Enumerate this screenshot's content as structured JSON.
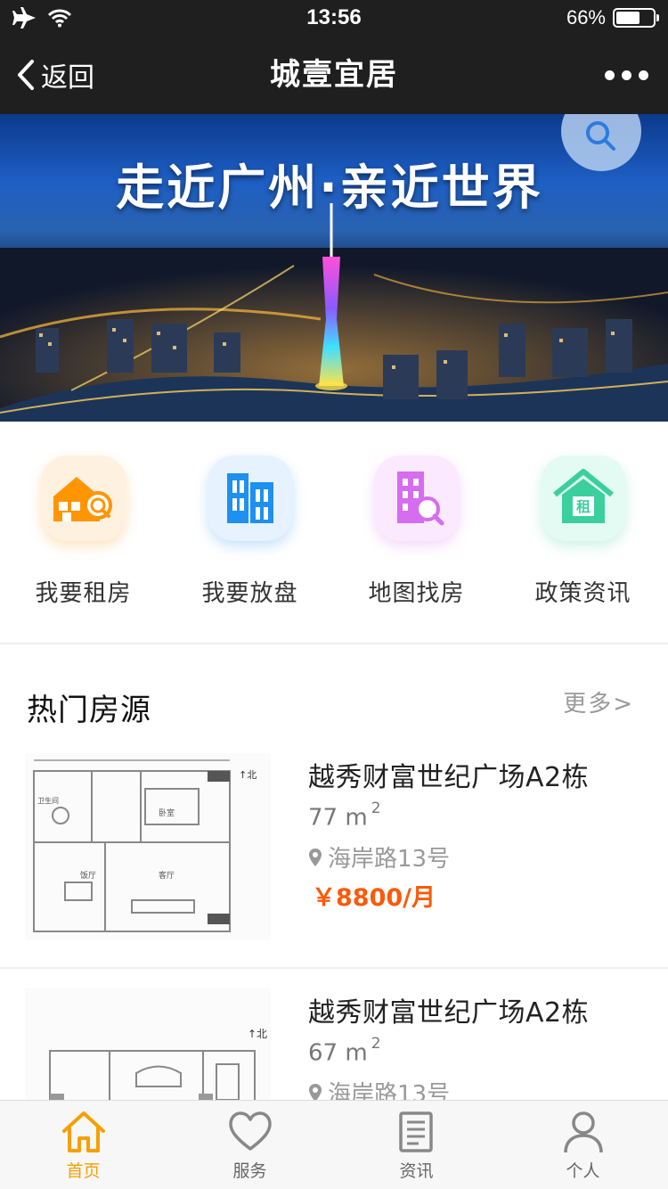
{
  "status_bar": {
    "time": "13:56",
    "battery_text": "66%",
    "battery_level": 0.66,
    "icons": [
      "airplane-icon",
      "wifi-icon",
      "battery-icon"
    ]
  },
  "nav": {
    "back_label": "返回",
    "title": "城壹宜居",
    "more_icon": "more-dots-icon"
  },
  "banner": {
    "title": "走近广州·亲近世界",
    "search_icon": "search-icon"
  },
  "quick_entries": [
    {
      "label": "我要租房",
      "icon": "house-search-icon",
      "color": "#ff9500"
    },
    {
      "label": "我要放盘",
      "icon": "buildings-icon",
      "color": "#1e90f0"
    },
    {
      "label": "地图找房",
      "icon": "building-search-icon",
      "color": "#d66cf0"
    },
    {
      "label": "政策资讯",
      "icon": "rent-house-icon",
      "color": "#3ccf9e"
    }
  ],
  "hot": {
    "title": "热门房源",
    "more_label": "更多>"
  },
  "listings": [
    {
      "title": "越秀财富世纪广场A2栋",
      "area": "77 m",
      "area_unit_sup": "2",
      "address": "海岸路13号",
      "price": "￥8800/月"
    },
    {
      "title": "越秀财富世纪广场A2栋",
      "area": "67 m",
      "area_unit_sup": "2",
      "address": "海岸路13号"
    }
  ],
  "tab_bar": [
    {
      "label": "首页",
      "icon": "home-icon",
      "active": true
    },
    {
      "label": "服务",
      "icon": "heart-icon",
      "active": false
    },
    {
      "label": "资讯",
      "icon": "news-icon",
      "active": false
    },
    {
      "label": "个人",
      "icon": "person-icon",
      "active": false
    }
  ],
  "colors": {
    "accent": "#f5a000",
    "price": "#fa5a0a",
    "header_bg": "#1f1f1f"
  }
}
